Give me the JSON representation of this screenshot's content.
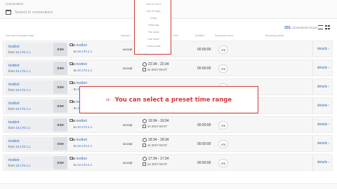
{
  "filter": {
    "label": "Connections",
    "search_placeholder": "Search in connections"
  },
  "hits": {
    "count": "291",
    "label": "connections found"
  },
  "columns": {
    "user": "User and connection data",
    "decision": "Decision",
    "time": "Time",
    "duration": "Duration",
    "score": "Suspicious score",
    "recording": "Recording status"
  },
  "time_dropdown": {
    "options": [
      "Last 24 hours",
      "Last 30 days",
      "Today",
      "Yesterday",
      "This week",
      "Last week",
      "Custom date"
    ],
    "more_label": "All time"
  },
  "callout": {
    "arrow_icon": "arrow-right",
    "text": "You can select a preset time range"
  },
  "rows": [
    {
      "name": "testbot",
      "from_label": "from",
      "from_ip": "10.170.1.1",
      "proto": "SSH",
      "as_label": "as",
      "as_user": "testbot",
      "to_label": "to",
      "to_ip": "10.170.1.1",
      "decision": "accept",
      "time": "",
      "date": "",
      "duration": "00:00:00",
      "score": "n/a",
      "details": "details ›"
    },
    {
      "name": "testbot",
      "from_label": "from",
      "from_ip": "10.170.1.1",
      "proto": "SSH",
      "as_label": "as",
      "as_user": "testbot",
      "to_label": "to",
      "to_ip": "10.170.1.1",
      "decision": "accept",
      "time": "22:34 - 22:34",
      "date": "on 2017-03-07",
      "duration": "00:00:00",
      "score": "n/a",
      "details": "details ›"
    },
    {
      "name": "testbot",
      "from_label": "from",
      "from_ip": "10.170.1.1",
      "proto": "SSH",
      "as_label": "as",
      "as_user": "testbot",
      "to_label": "to",
      "to_ip": "10.170.1.1",
      "decision": "",
      "time": "",
      "date": "",
      "duration": "",
      "score": "n/a",
      "details": "details ›"
    },
    {
      "name": "testbot",
      "from_label": "from",
      "from_ip": "10.170.1.1",
      "proto": "SSH",
      "as_label": "as",
      "as_user": "testbot",
      "to_label": "to",
      "to_ip": "10.170.1.1",
      "decision": "",
      "time": "",
      "date": "",
      "duration": "",
      "score": "n/a",
      "details": "details ›"
    },
    {
      "name": "testbot",
      "from_label": "from",
      "from_ip": "10.170.1.1",
      "proto": "SSH",
      "as_label": "as",
      "as_user": "testbot",
      "to_label": "to",
      "to_ip": "10.170.1.1",
      "decision": "accept",
      "time": "19:34 - 19:34",
      "date": "on 2017-03-07",
      "duration": "00:00:00",
      "score": "n/a",
      "details": "details ›"
    },
    {
      "name": "testbot",
      "from_label": "from",
      "from_ip": "10.170.1.1",
      "proto": "SSH",
      "as_label": "as",
      "as_user": "testbot",
      "to_label": "to",
      "to_ip": "10.170.1.1",
      "decision": "accept",
      "time": "18:34 - 18:34",
      "date": "on 2017-03-07",
      "duration": "00:00:00",
      "score": "n/a",
      "details": "details ›"
    },
    {
      "name": "testbot",
      "from_label": "from",
      "from_ip": "10.170.1.1",
      "proto": "SSH",
      "as_label": "as",
      "as_user": "testbot",
      "to_label": "to",
      "to_ip": "10.170.1.1",
      "decision": "accept",
      "time": "17:34 - 17:34",
      "date": "on 2017-03-07",
      "duration": "00:00:00",
      "score": "n/a",
      "details": "details ›"
    }
  ]
}
